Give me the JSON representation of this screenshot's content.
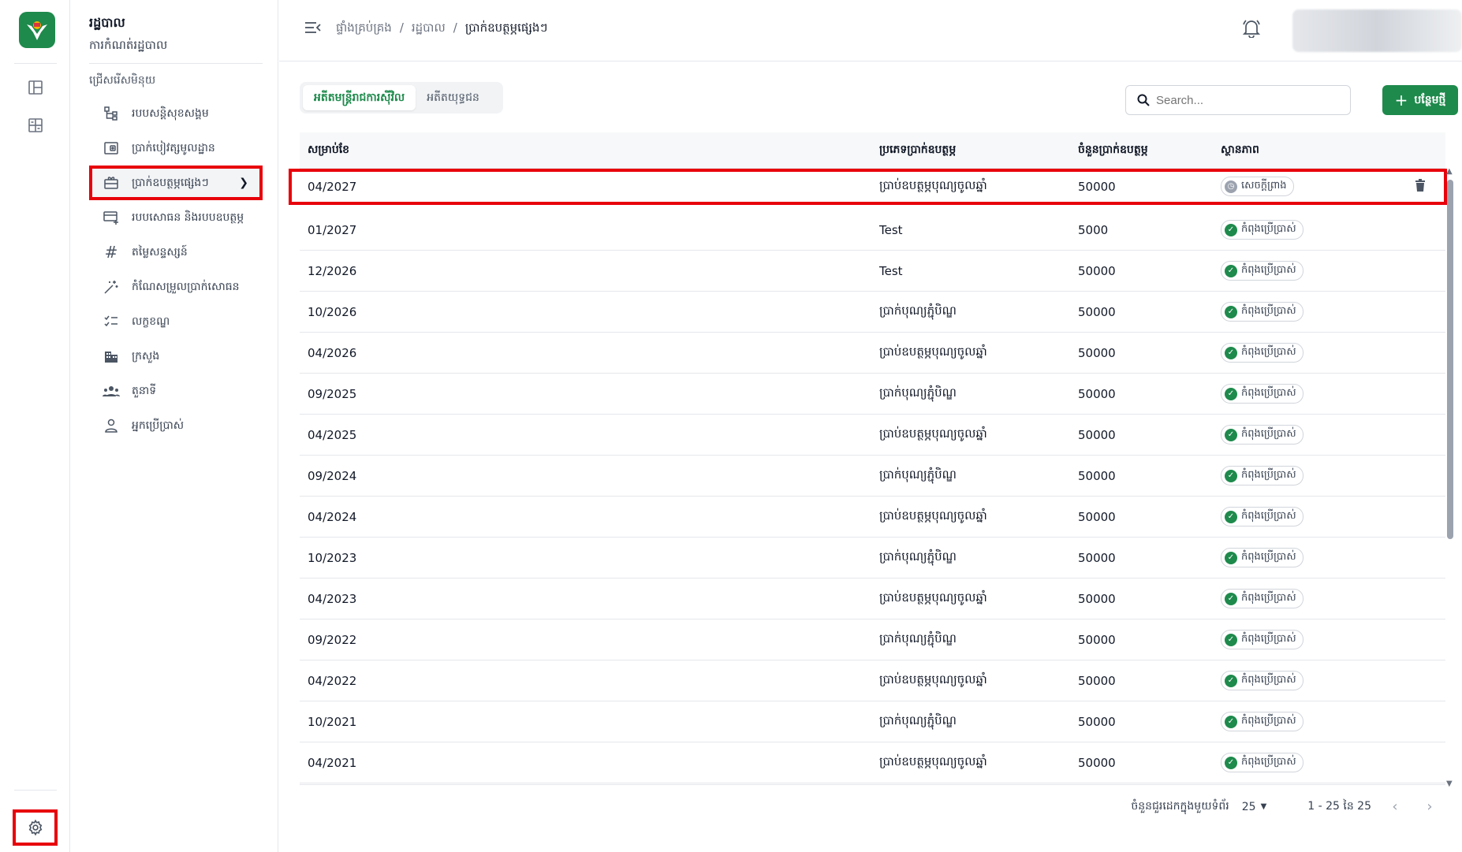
{
  "app": {
    "module_title": "រដ្ឋបាល",
    "module_subtitle": "ការកំណត់រដ្ឋបាល"
  },
  "sidebar": {
    "section_label": "ជ្រើសរើសមិនុយ",
    "items": [
      {
        "label": "របបសន្តិសុខសង្គម",
        "icon": "hierarchy-icon"
      },
      {
        "label": "ប្រាក់បៀវត្សមូលដ្ឋាន",
        "icon": "wallet-icon"
      },
      {
        "label": "ប្រាក់ឧបត្ថម្ភផ្សេងៗ",
        "icon": "gift-icon"
      },
      {
        "label": "របបសោធន និងរបបឧបត្ថម្ភ",
        "icon": "card-add-icon"
      },
      {
        "label": "តម្លៃសន្ទស្សន៍",
        "icon": "hashtag-icon"
      },
      {
        "label": "កំណែសម្រួលប្រាក់សោធន",
        "icon": "sparkle-icon"
      },
      {
        "label": "លក្ខខណ្ឌ",
        "icon": "checklist-icon"
      },
      {
        "label": "ក្រសួង",
        "icon": "building-icon"
      },
      {
        "label": "តួនាទី",
        "icon": "people-icon"
      },
      {
        "label": "អ្នកប្រើប្រាស់",
        "icon": "user-icon"
      }
    ]
  },
  "header": {
    "breadcrumb": [
      "ផ្ទាំងគ្រប់គ្រង",
      "រដ្ឋបាល",
      "ប្រាក់ឧបត្ថម្ភផ្សេងៗ"
    ],
    "separator": "/"
  },
  "tabs": [
    "អតីតមន្ត្រីរាជការស៊ីវិល",
    "អតីតយុទ្ធជន"
  ],
  "search": {
    "placeholder": "Search..."
  },
  "add_button": {
    "label": "បន្ថែមថ្មី"
  },
  "table": {
    "columns": [
      "សម្រាប់ខែ",
      "ប្រភេទប្រាក់ឧបត្ថម្ភ",
      "ចំនួនប្រាក់ឧបត្ថម្ភ",
      "ស្ថានភាព"
    ],
    "rows": [
      {
        "month": "04/2027",
        "type": "ប្រាប់ឧបត្ថម្ភបុណ្យចូលឆ្នាំ",
        "amount": "50000",
        "status": "សេចក្ដីព្រាង"
      },
      {
        "month": "01/2027",
        "type": "Test",
        "amount": "5000",
        "status": "កំពុងប្រើប្រាស់"
      },
      {
        "month": "12/2026",
        "type": "Test",
        "amount": "50000",
        "status": "កំពុងប្រើប្រាស់"
      },
      {
        "month": "10/2026",
        "type": "ប្រាក់បុណ្យភ្ជុំបិណ្ឌ",
        "amount": "50000",
        "status": "កំពុងប្រើប្រាស់"
      },
      {
        "month": "04/2026",
        "type": "ប្រាប់ឧបត្ថម្ភបុណ្យចូលឆ្នាំ",
        "amount": "50000",
        "status": "កំពុងប្រើប្រាស់"
      },
      {
        "month": "09/2025",
        "type": "ប្រាក់បុណ្យភ្ជុំបិណ្ឌ",
        "amount": "50000",
        "status": "កំពុងប្រើប្រាស់"
      },
      {
        "month": "04/2025",
        "type": "ប្រាប់ឧបត្ថម្ភបុណ្យចូលឆ្នាំ",
        "amount": "50000",
        "status": "កំពុងប្រើប្រាស់"
      },
      {
        "month": "09/2024",
        "type": "ប្រាក់បុណ្យភ្ជុំបិណ្ឌ",
        "amount": "50000",
        "status": "កំពុងប្រើប្រាស់"
      },
      {
        "month": "04/2024",
        "type": "ប្រាប់ឧបត្ថម្ភបុណ្យចូលឆ្នាំ",
        "amount": "50000",
        "status": "កំពុងប្រើប្រាស់"
      },
      {
        "month": "10/2023",
        "type": "ប្រាក់បុណ្យភ្ជុំបិណ្ឌ",
        "amount": "50000",
        "status": "កំពុងប្រើប្រាស់"
      },
      {
        "month": "04/2023",
        "type": "ប្រាប់ឧបត្ថម្ភបុណ្យចូលឆ្នាំ",
        "amount": "50000",
        "status": "កំពុងប្រើប្រាស់"
      },
      {
        "month": "09/2022",
        "type": "ប្រាក់បុណ្យភ្ជុំបិណ្ឌ",
        "amount": "50000",
        "status": "កំពុងប្រើប្រាស់"
      },
      {
        "month": "04/2022",
        "type": "ប្រាប់ឧបត្ថម្ភបុណ្យចូលឆ្នាំ",
        "amount": "50000",
        "status": "កំពុងប្រើប្រាស់"
      },
      {
        "month": "10/2021",
        "type": "ប្រាក់បុណ្យភ្ជុំបិណ្ឌ",
        "amount": "50000",
        "status": "កំពុងប្រើប្រាស់"
      },
      {
        "month": "04/2021",
        "type": "ប្រាប់ឧបត្ថម្ភបុណ្យចូលឆ្នាំ",
        "amount": "50000",
        "status": "កំពុងប្រើប្រាស់"
      }
    ]
  },
  "pagination": {
    "rows_per_page_label": "ចំនួនជួរដេកក្នុងមួយទំព័រ",
    "rows_per_page": "25",
    "range": "1 - 25 នៃ 25"
  },
  "colors": {
    "brand": "#1e8a4c",
    "highlight": "#e8000b"
  }
}
